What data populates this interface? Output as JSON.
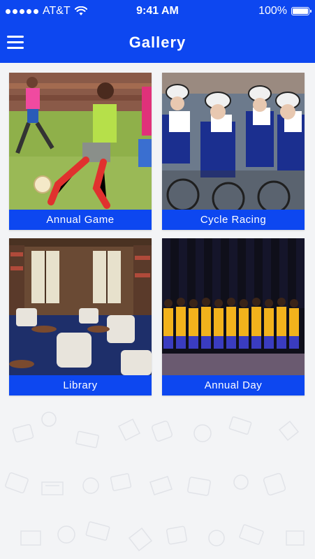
{
  "status_bar": {
    "carrier": "AT&T",
    "time": "9:41 AM",
    "battery": "100%"
  },
  "header": {
    "title": "Gallery",
    "menu_icon": "hamburger-menu-icon"
  },
  "gallery": {
    "items": [
      {
        "label": "Annual Game"
      },
      {
        "label": "Cycle Racing"
      },
      {
        "label": "Library"
      },
      {
        "label": "Annual Day"
      }
    ]
  },
  "colors": {
    "primary": "#0d47f0",
    "background": "#f3f4f6"
  }
}
